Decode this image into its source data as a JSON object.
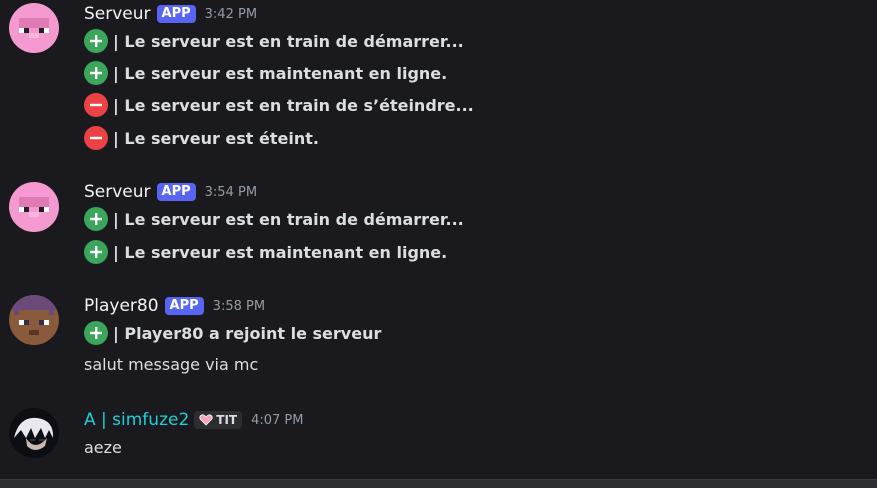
{
  "messages": [
    {
      "author": "Serveur",
      "badge": "APP",
      "time": "3:42 PM",
      "lines": [
        {
          "icon": "plus",
          "text": "| Le serveur est en train de démarrer..."
        },
        {
          "icon": "plus",
          "text": "| Le serveur est maintenant en ligne."
        },
        {
          "icon": "minus",
          "text": "| Le serveur est en train de s’éteindre..."
        },
        {
          "icon": "minus",
          "text": "| Le serveur est éteint."
        }
      ]
    },
    {
      "author": "Serveur",
      "badge": "APP",
      "time": "3:54 PM",
      "lines": [
        {
          "icon": "plus",
          "text": "| Le serveur est en train de démarrer..."
        },
        {
          "icon": "plus",
          "text": "| Le serveur est maintenant en ligne."
        }
      ]
    },
    {
      "author": "Player80",
      "badge": "APP",
      "time": "3:58 PM",
      "lines": [
        {
          "icon": "plus",
          "text": "| Player80 a rejoint le serveur"
        }
      ],
      "plain": "salut message via mc"
    },
    {
      "author": "A | simfuze2",
      "role_tag": "TIT",
      "time": "4:07 PM",
      "plain": "aeze"
    }
  ],
  "colors": {
    "background": "#1a1a1e",
    "app_badge": "#5865f2",
    "add_icon": "#3ba55c",
    "remove_icon": "#ed4245",
    "cyan_author": "#1dd1d6"
  }
}
